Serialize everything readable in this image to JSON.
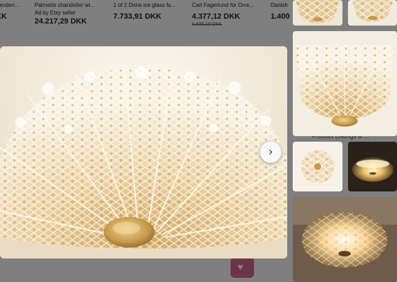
{
  "background_listings": [
    {
      "title": "Penden...",
      "price": ""
    },
    {
      "title": "Palmette chandelier wi...",
      "seller": "Ad by Etsy seller",
      "price": "24.217,29 DKK"
    },
    {
      "title": "1 of 2 Doria ice glass fu...",
      "price": "7.733,91 DKK"
    },
    {
      "title": "Carl Fagerlund for Orre...",
      "price": "4.377,12 DKK",
      "original_price": "6.838,18 DKK"
    },
    {
      "title": "Danish",
      "price": "1.400"
    }
  ],
  "background_fragments": {
    "left_price_tail": "KK",
    "side_label": "Product Listings & ..."
  },
  "viewer": {
    "main_image_alt": "Crystal glass ceiling lamp with brass center",
    "next_button_symbol": "›"
  },
  "thumbnails": [
    {
      "name": "thumb-1",
      "desc": "crystal lamp top crop"
    },
    {
      "name": "thumb-2",
      "desc": "crystal lamp top crop"
    },
    {
      "name": "thumb-3",
      "desc": "crystal lamp detail"
    },
    {
      "name": "thumb-4",
      "desc": "lamp from below"
    },
    {
      "name": "thumb-5",
      "desc": "lamp lit in dark"
    },
    {
      "name": "thumb-6",
      "desc": "lamp lit ceiling"
    }
  ],
  "colors": {
    "crystal_light": "#f6efe3",
    "crystal_gold": "#d9b67c",
    "brass": "#c9a35a",
    "dark_bg": "#3a2f24"
  }
}
